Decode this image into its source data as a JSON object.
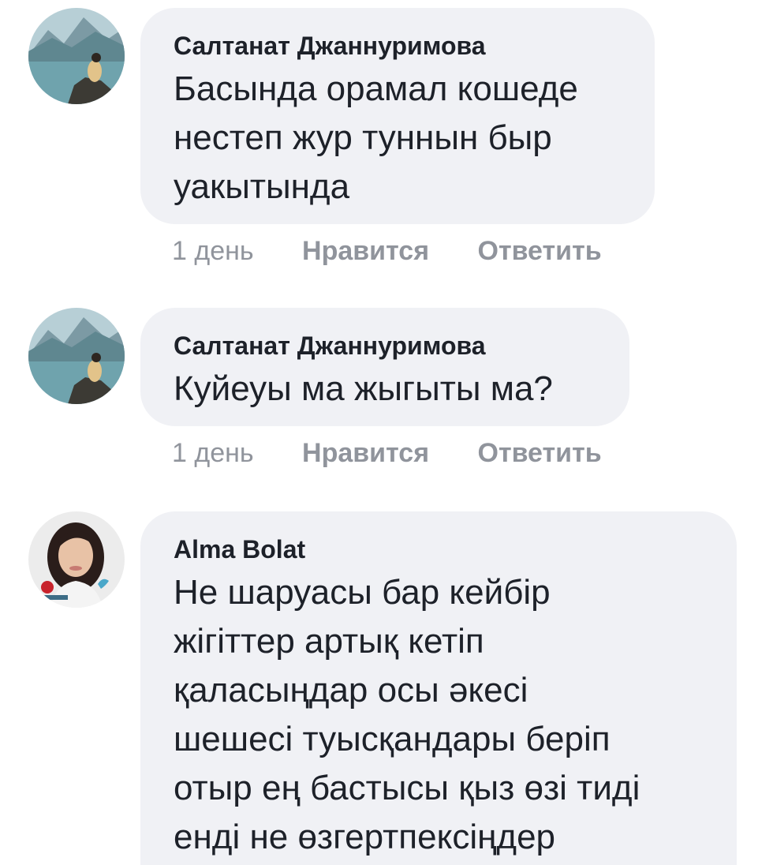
{
  "comments": [
    {
      "author": "Салтанат Джаннуримова",
      "avatar_icon": "lake-landscape-avatar",
      "text_lines": [
        "Басында орамал кошеде",
        "нестеп жур туннын быр",
        "уакытында"
      ],
      "time": "1 день",
      "like_label": "Нравится",
      "reply_label": "Ответить"
    },
    {
      "author": "Салтанат Джаннуримова",
      "avatar_icon": "lake-landscape-avatar",
      "text_lines": [
        "Куйеуы ма жыгыты ма?"
      ],
      "time": "1 день",
      "like_label": "Нравится",
      "reply_label": "Ответить"
    },
    {
      "author": "Alma Bolat",
      "avatar_icon": "woman-portrait-avatar",
      "text_lines": [
        "Не шаруасы бар кейбір",
        "жігіттер артық кетіп",
        "қаласыңдар осы әкесі",
        "шешесі туысқандары беріп",
        "отыр ең бастысы қыз өзі тиді",
        "енді не өзгертпексіңдер"
      ]
    }
  ],
  "colors": {
    "bubble_bg": "#f0f1f5",
    "text": "#1d2129",
    "meta": "#90949c"
  }
}
